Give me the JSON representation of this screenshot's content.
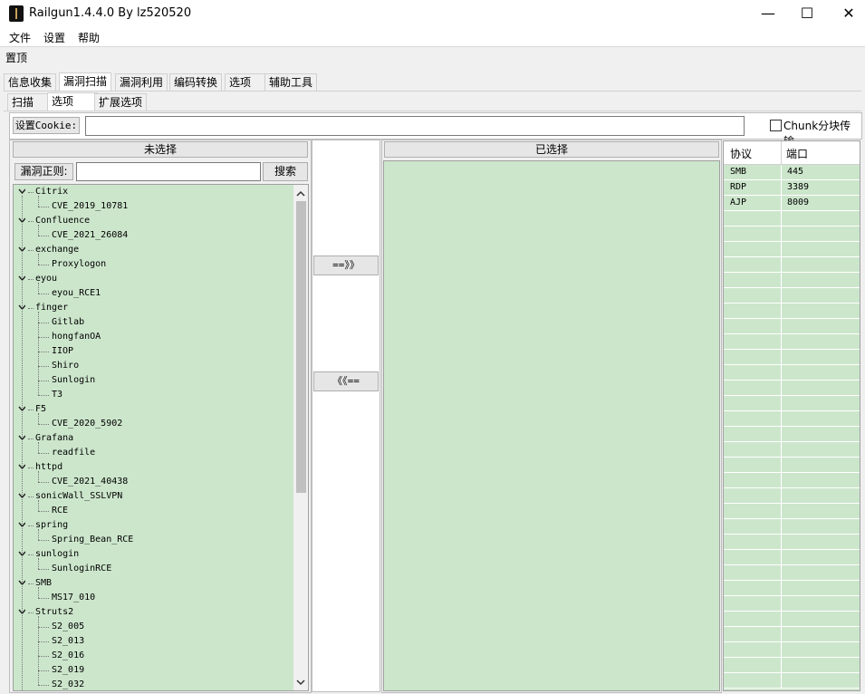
{
  "window": {
    "title": "Railgun1.4.4.0 By lz520520",
    "controls": {
      "minimize": "—",
      "maximize": "☐",
      "close": "✕"
    }
  },
  "menu": [
    "文件",
    "设置",
    "帮助"
  ],
  "pin_label": "置顶",
  "main_tabs": [
    "信息收集",
    "漏洞扫描",
    "漏洞利用",
    "编码转换",
    "选项",
    "辅助工具"
  ],
  "main_tabs_active": "漏洞扫描",
  "sub_tabs": [
    "扫描",
    "选项",
    "扩展选项"
  ],
  "sub_tabs_active": "选项",
  "cookie": {
    "label": "设置Cookie:",
    "value": "",
    "chunk_label": "Chunk分块传输",
    "chunk_checked": false
  },
  "unselected": {
    "header": "未选择",
    "regex_label": "漏洞正则:",
    "regex_value": "",
    "search_button": "搜索",
    "tree": [
      {
        "name": "Citrix",
        "children": [
          "CVE_2019_10781"
        ]
      },
      {
        "name": "Confluence",
        "children": [
          "CVE_2021_26084"
        ]
      },
      {
        "name": "exchange",
        "children": [
          "Proxylogon"
        ]
      },
      {
        "name": "eyou",
        "children": [
          "eyou_RCE1"
        ]
      },
      {
        "name": "finger",
        "children": [
          "Gitlab",
          "hongfanOA",
          "IIOP",
          "Shiro",
          "Sunlogin",
          "T3"
        ]
      },
      {
        "name": "F5",
        "children": [
          "CVE_2020_5902"
        ]
      },
      {
        "name": "Grafana",
        "children": [
          "readfile"
        ]
      },
      {
        "name": "httpd",
        "children": [
          "CVE_2021_40438"
        ]
      },
      {
        "name": "sonicWall_SSLVPN",
        "children": [
          "RCE"
        ]
      },
      {
        "name": "spring",
        "children": [
          "Spring_Bean_RCE"
        ]
      },
      {
        "name": "sunlogin",
        "children": [
          "SunloginRCE"
        ]
      },
      {
        "name": "SMB",
        "children": [
          "MS17_010"
        ]
      },
      {
        "name": "Struts2",
        "children": [
          "S2_005",
          "S2_013",
          "S2_016",
          "S2_019",
          "S2_032"
        ]
      }
    ]
  },
  "move_right_button": "==》》",
  "move_left_button": "《《==",
  "selected": {
    "header": "已选择"
  },
  "ports": {
    "headers": [
      "协议",
      "端口"
    ],
    "rows": [
      [
        "SMB",
        "445"
      ],
      [
        "RDP",
        "3389"
      ],
      [
        "AJP",
        "8009"
      ]
    ]
  },
  "colors": {
    "tree_bg": "#cce6cc",
    "panel_border": "#a0a0a0"
  }
}
